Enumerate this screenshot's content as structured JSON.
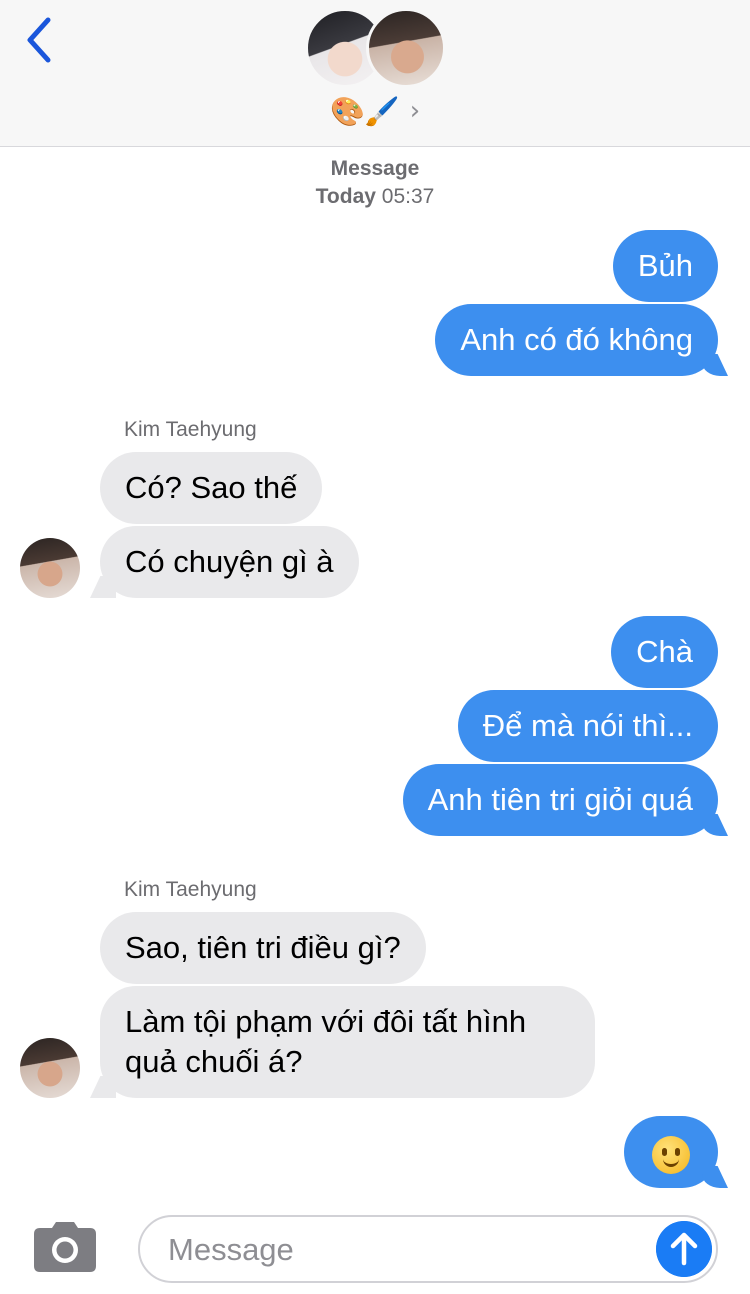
{
  "header": {
    "back_icon": "chevron-left-icon",
    "group_name": "🎨🖌️",
    "chevron": "›"
  },
  "timestamp": {
    "line1": "Message",
    "day": "Today",
    "time": "05:37"
  },
  "messages": [
    {
      "from": "me",
      "text": "Bủh"
    },
    {
      "from": "me",
      "text": "Anh có đó không"
    },
    {
      "from": "Kim Taehyung",
      "text": "Có? Sao thế"
    },
    {
      "from": "Kim Taehyung",
      "text": "Có chuyện gì à"
    },
    {
      "from": "me",
      "text": "Chà"
    },
    {
      "from": "me",
      "text": "Để mà nói thì..."
    },
    {
      "from": "me",
      "text": "Anh tiên tri giỏi quá"
    },
    {
      "from": "Kim Taehyung",
      "text": "Sao, tiên tri điều gì?"
    },
    {
      "from": "Kim Taehyung",
      "text": "Làm tội phạm với đôi tất hình quả chuối á?"
    },
    {
      "from": "me",
      "text": "",
      "emoji": "slightly-smiling-face-icon"
    }
  ],
  "senders": [
    "Kim Taehyung",
    "Kim Taehyung"
  ],
  "compose": {
    "placeholder": "Message",
    "camera_icon": "camera-icon",
    "send_icon": "arrow-up-icon"
  },
  "colors": {
    "outgoing": "#3d8fef",
    "incoming": "#e9e9eb",
    "accent": "#1a7cf5"
  }
}
